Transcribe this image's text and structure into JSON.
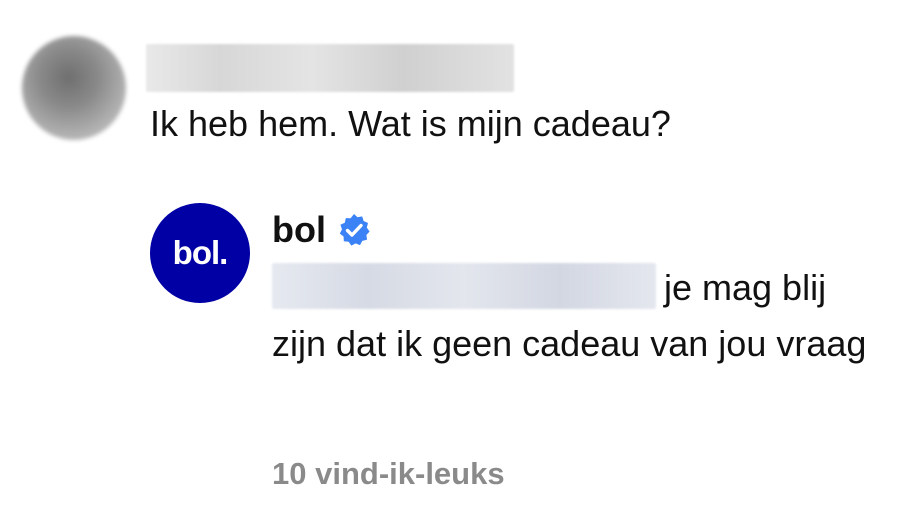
{
  "comment": {
    "text": "Ik heb hem. Wat is mijn cadeau?"
  },
  "reply": {
    "avatar_text": "bol.",
    "author": "bol",
    "verified_icon": "verified-check-icon",
    "body": "je mag blij zijn dat ik geen cadeau van jou vraag",
    "likes": "10 vind-ik-leuks"
  },
  "colors": {
    "brand": "#0000a4",
    "verified": "#3b82f6",
    "muted": "#8a8a8a"
  }
}
